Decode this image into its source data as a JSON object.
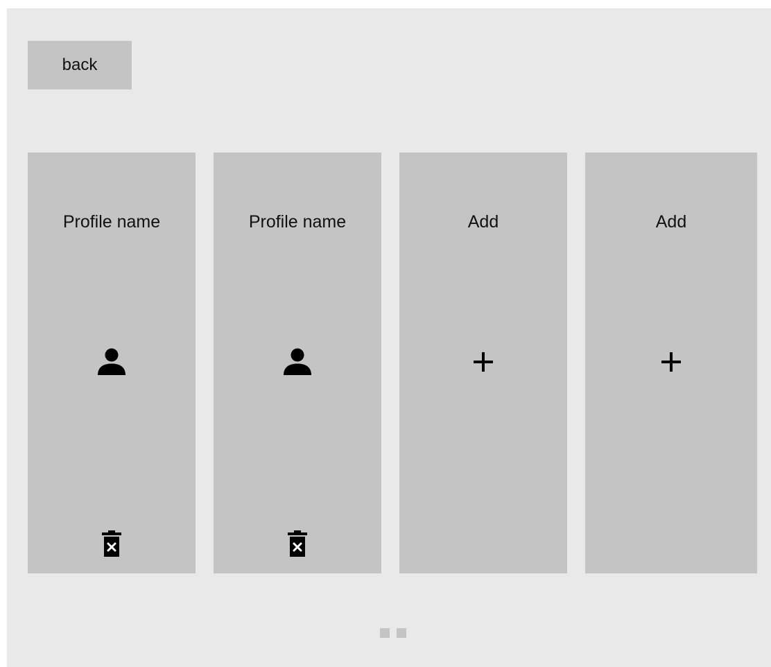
{
  "header": {
    "back_label": "back"
  },
  "profiles": [
    {
      "title": "Profile name",
      "icon": "person-icon",
      "has_delete": true,
      "delete_icon": "trash-x-icon"
    },
    {
      "title": "Profile name",
      "icon": "person-icon",
      "has_delete": true,
      "delete_icon": "trash-x-icon"
    },
    {
      "title": "Add",
      "icon": "plus-icon",
      "has_delete": false
    },
    {
      "title": "Add",
      "icon": "plus-icon",
      "has_delete": false
    }
  ],
  "pagination": {
    "page_count": 2
  },
  "colors": {
    "background": "#e9e9e9",
    "card": "#c4c4c4",
    "text": "#111111"
  }
}
